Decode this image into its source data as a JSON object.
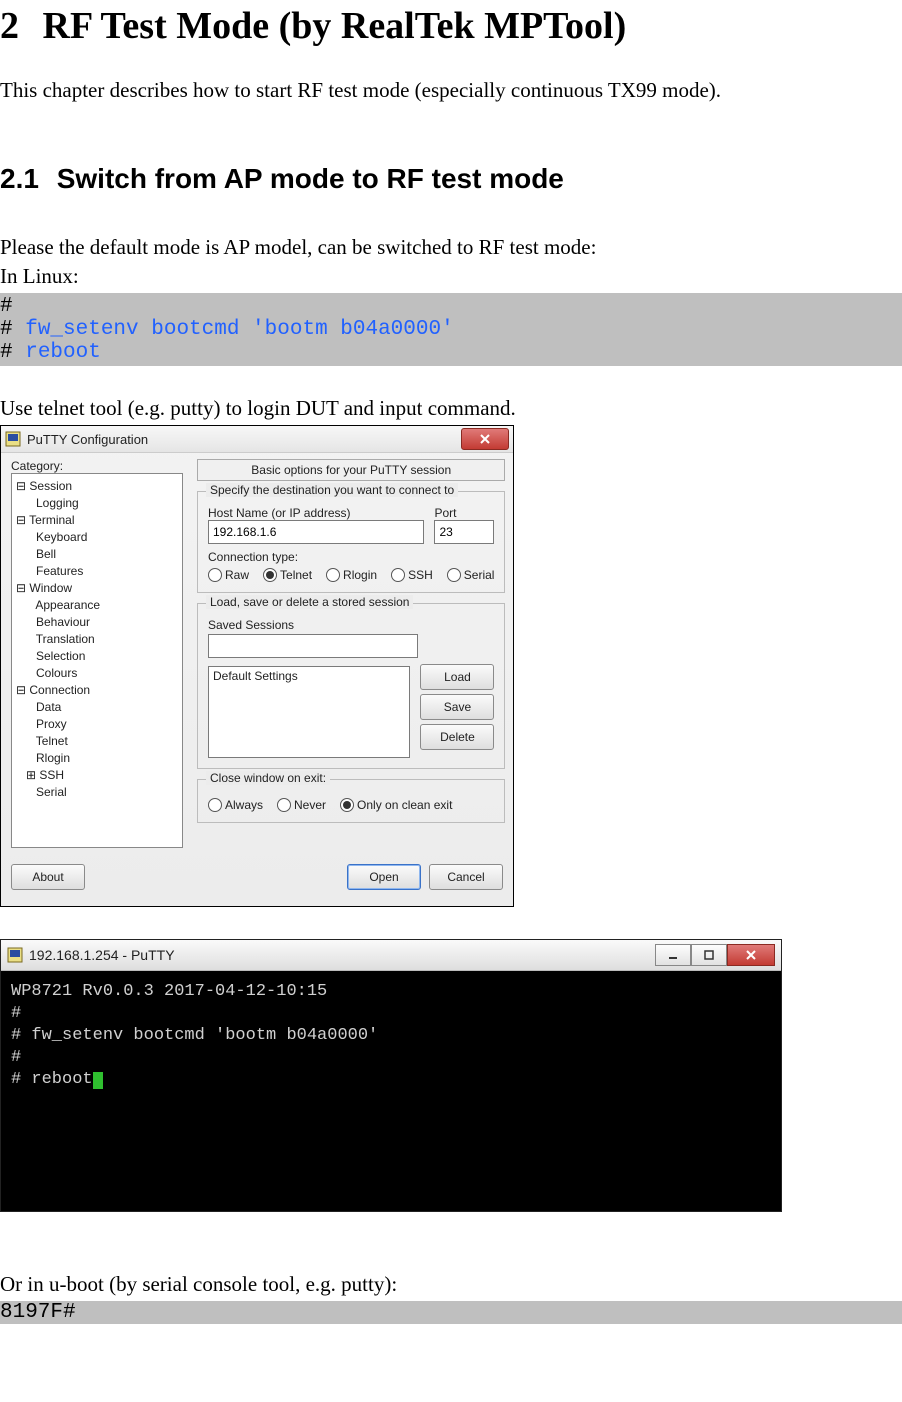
{
  "heading": {
    "num": "2",
    "title": "RF Test Mode (by RealTek MPTool)"
  },
  "intro": "This chapter describes how to start RF test mode (especially continuous TX99 mode).",
  "sec": {
    "num": "2.1",
    "title": "Switch from AP mode to RF test mode"
  },
  "p1": "Please the default mode is AP model, can be switched to RF test mode:",
  "p2": "In Linux:",
  "code": {
    "h1": "#",
    "h2": "#",
    "cmd1": "fw_setenv bootcmd 'bootm b04a0000'",
    "h3": "#",
    "cmd2": "reboot"
  },
  "p3": "Use telnet tool (e.g. putty) to login DUT and input command.",
  "putty": {
    "title": "PuTTY Configuration",
    "category_label": "Category:",
    "tree": [
      "⊟ Session",
      "      Logging",
      "⊟ Terminal",
      "      Keyboard",
      "      Bell",
      "      Features",
      "⊟ Window",
      "      Appearance",
      "      Behaviour",
      "      Translation",
      "      Selection",
      "      Colours",
      "⊟ Connection",
      "      Data",
      "      Proxy",
      "      Telnet",
      "      Rlogin",
      "   ⊞ SSH",
      "      Serial"
    ],
    "panel_header": "Basic options for your PuTTY session",
    "group1_legend": "Specify the destination you want to connect to",
    "host_label": "Host Name (or IP address)",
    "port_label": "Port",
    "host_value": "192.168.1.6",
    "port_value": "23",
    "conntype_label": "Connection type:",
    "conntypes": [
      "Raw",
      "Telnet",
      "Rlogin",
      "SSH",
      "Serial"
    ],
    "conntype_selected": "Telnet",
    "group2_legend": "Load, save or delete a stored session",
    "saved_label": "Saved Sessions",
    "list_item": "Default Settings",
    "btn_load": "Load",
    "btn_save": "Save",
    "btn_delete": "Delete",
    "group3_legend": "Close window on exit:",
    "exit_opts": [
      "Always",
      "Never",
      "Only on clean exit"
    ],
    "exit_selected": "Only on clean exit",
    "btn_about": "About",
    "btn_open": "Open",
    "btn_cancel": "Cancel"
  },
  "terminal": {
    "title": "192.168.1.254 - PuTTY",
    "lines": [
      "WP8721 Rv0.0.3 2017-04-12-10:15",
      "#",
      "# fw_setenv bootcmd 'bootm b04a0000'",
      "#",
      "# reboot"
    ]
  },
  "p4": "Or in u-boot (by serial console tool, e.g. putty):",
  "lastprompt": "8197F#"
}
